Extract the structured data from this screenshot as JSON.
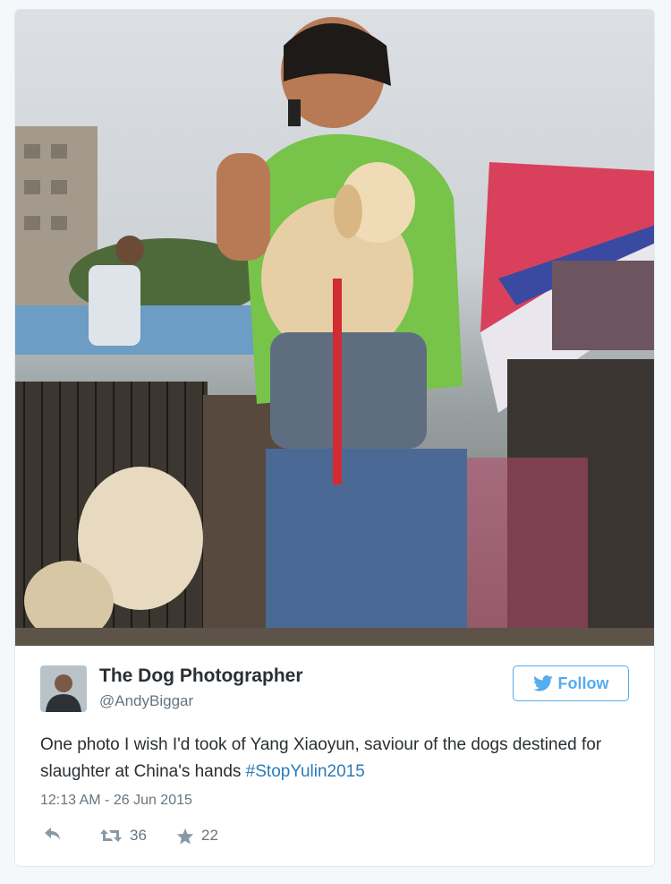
{
  "tweet": {
    "author": {
      "display_name": "The Dog Photographer",
      "handle": "@AndyBiggar",
      "avatar_icon": "user-avatar-photo"
    },
    "follow_button": {
      "label": "Follow",
      "icon": "twitter-bird-icon",
      "color": "#55acee"
    },
    "text": "One photo I wish I'd took of Yang Xiaoyun, saviour of the dogs destined for slaughter at China's hands",
    "hashtag": "#StopYulin2015",
    "timestamp": "12:13 AM - 26 Jun 2015",
    "actions": {
      "reply_icon": "reply-icon",
      "retweet_icon": "retweet-icon",
      "retweet_count": "36",
      "favorite_icon": "star-icon",
      "favorite_count": "22"
    },
    "colors": {
      "link": "#2b7bb9",
      "text": "#292f33",
      "meta": "#66757f",
      "accent": "#55acee"
    }
  }
}
